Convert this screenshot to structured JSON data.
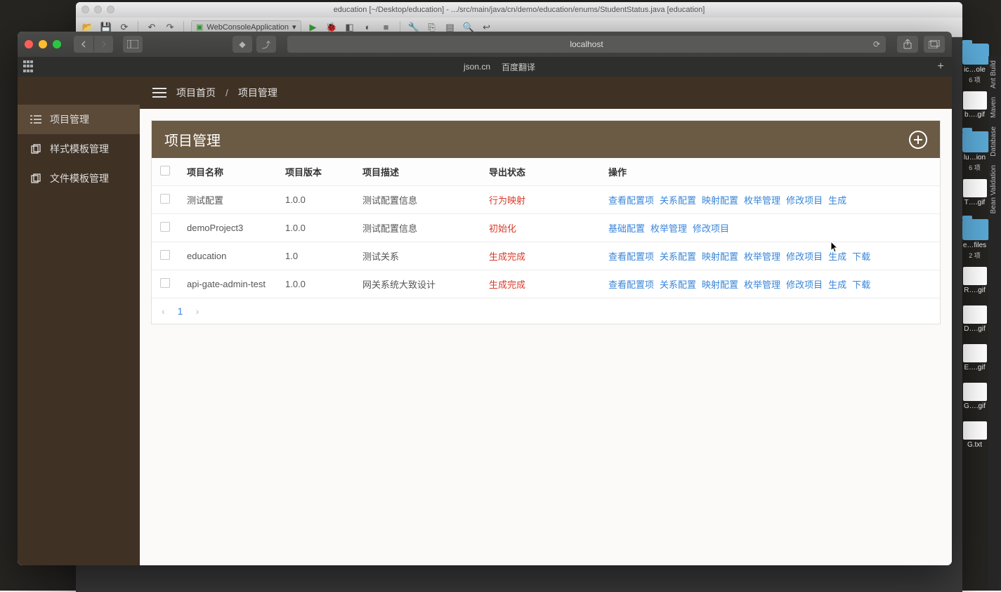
{
  "ide": {
    "title": "education [~/Desktop/education] - .../src/main/java/cn/demo/education/enums/StudentStatus.java [education]",
    "run_config": "WebConsoleApplication"
  },
  "safari": {
    "url": "localhost",
    "fav1": "json.cn",
    "fav2": "百度翻译"
  },
  "sidebar": {
    "items": [
      {
        "label": "项目管理"
      },
      {
        "label": "样式模板管理"
      },
      {
        "label": "文件模板管理"
      }
    ]
  },
  "breadcrumb": {
    "home": "项目首页",
    "current": "项目管理"
  },
  "panel": {
    "title": "项目管理"
  },
  "table": {
    "headers": {
      "name": "项目名称",
      "version": "项目版本",
      "desc": "项目描述",
      "status": "导出状态",
      "ops": "操作"
    },
    "rows": [
      {
        "name": "测试配置",
        "version": "1.0.0",
        "desc": "测试配置信息",
        "status": "行为映射",
        "actions": [
          "查看配置项",
          "关系配置",
          "映射配置",
          "枚举管理",
          "修改项目",
          "生成"
        ]
      },
      {
        "name": "demoProject3",
        "version": "1.0.0",
        "desc": "测试配置信息",
        "status": "初始化",
        "actions": [
          "基础配置",
          "枚举管理",
          "修改项目"
        ]
      },
      {
        "name": "education",
        "version": "1.0",
        "desc": "测试关系",
        "status": "生成完成",
        "actions": [
          "查看配置项",
          "关系配置",
          "映射配置",
          "枚举管理",
          "修改项目",
          "生成",
          "下载"
        ]
      },
      {
        "name": "api-gate-admin-test",
        "version": "1.0.0",
        "desc": "网关系统大致设计",
        "status": "生成完成",
        "actions": [
          "查看配置项",
          "关系配置",
          "映射配置",
          "枚举管理",
          "修改项目",
          "生成",
          "下载"
        ]
      }
    ]
  },
  "pager": {
    "page": "1"
  },
  "ghost": {
    "title": "education"
  },
  "dock": {
    "items": [
      {
        "label": "ic…ole",
        "count": "6 项",
        "type": "folder"
      },
      {
        "label": "b….gif",
        "type": "file"
      },
      {
        "label": "lu…ion",
        "count": "6 项",
        "type": "folder"
      },
      {
        "label": "T….gif",
        "type": "file"
      },
      {
        "label": "e…files",
        "count": "2 项",
        "type": "folder"
      },
      {
        "label": "R….gif",
        "type": "file"
      },
      {
        "label": "D….gif",
        "type": "file"
      },
      {
        "label": "E….gif",
        "type": "file"
      },
      {
        "label": "G….gif",
        "type": "file"
      },
      {
        "label": "G.txt",
        "type": "file"
      }
    ],
    "vertical": [
      "Ant Build",
      "Maven",
      "Database",
      "Bean Validation"
    ]
  }
}
